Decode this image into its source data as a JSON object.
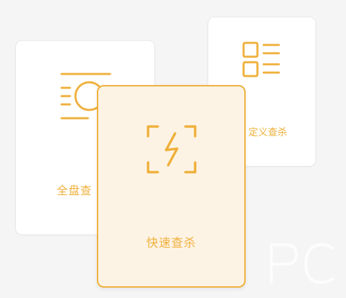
{
  "scan_modes": {
    "full": {
      "label": "全盘查",
      "icon": "full-disk-scan-icon"
    },
    "custom": {
      "label": "定义查杀",
      "icon": "custom-scan-list-icon"
    },
    "quick": {
      "label": "快速查杀",
      "icon": "quick-scan-lightning-icon",
      "selected": true
    }
  },
  "colors": {
    "accent": "#efb03b",
    "selected_card_bg": "#fdf3e4",
    "card_bg": "#ffffff",
    "background": "#f5f5f5"
  }
}
